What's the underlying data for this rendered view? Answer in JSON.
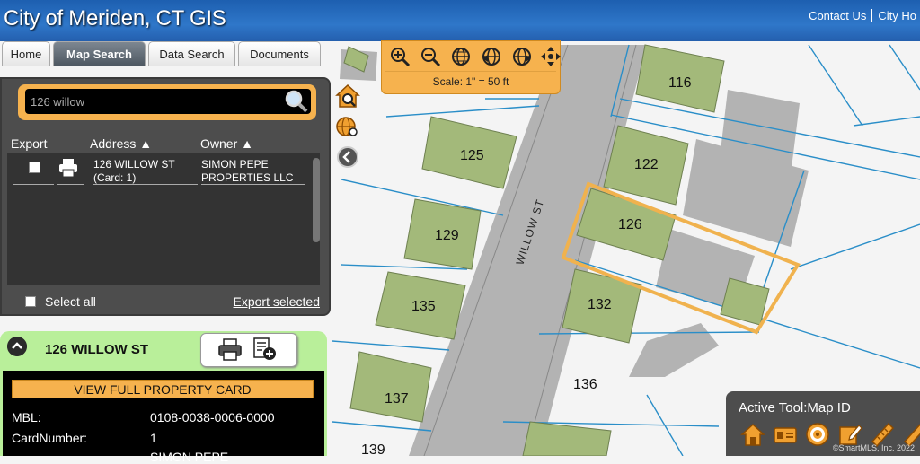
{
  "header": {
    "title": "City of Meriden, CT GIS",
    "links": [
      "Contact Us",
      "City Ho"
    ]
  },
  "tabs": [
    {
      "label": "Home",
      "active": false
    },
    {
      "label": "Map Search",
      "active": true
    },
    {
      "label": "Data Search",
      "active": false
    },
    {
      "label": "Documents",
      "active": false
    }
  ],
  "map_toolbar": {
    "tools": [
      "zoom-in-icon",
      "zoom-out-icon",
      "full-extent-globe-icon",
      "previous-extent-globe-icon",
      "next-extent-globe-icon",
      "pan-icon"
    ],
    "scale": "Scale: 1\" = 50 ft"
  },
  "search": {
    "value": "126 willow",
    "columns": {
      "export": "Export",
      "address": "Address ▲",
      "owner": "Owner ▲"
    },
    "results": [
      {
        "address_line1": "126 WILLOW ST",
        "address_line2": "(Card: 1)",
        "owner_line1": "SIMON PEPE",
        "owner_line2": "PROPERTIES LLC"
      }
    ],
    "select_all": "Select all",
    "export_selected": "Export selected"
  },
  "side_icons": [
    "home-search-icon",
    "globe-search-icon",
    "collapse-left-icon"
  ],
  "detail": {
    "address": "126 WILLOW ST",
    "view_card": "VIEW FULL PROPERTY CARD",
    "fields": [
      {
        "label": "MBL:",
        "value": "0108-0038-0006-0000"
      },
      {
        "label": "CardNumber:",
        "value": "1"
      },
      {
        "label": "",
        "value": "SIMON PEPE"
      }
    ]
  },
  "active_tool": {
    "label": "Active Tool:Map ID",
    "tools": [
      "home-icon",
      "id-card-icon",
      "target-icon",
      "edit-icon",
      "measure-icon",
      "ruler-icon"
    ],
    "copyright": "©SmartMLS, Inc. 2022"
  },
  "map": {
    "street_label": "WILLOW ST",
    "parcel_labels": [
      "116",
      "125",
      "122",
      "126",
      "129",
      "135",
      "132",
      "136",
      "137",
      "139"
    ],
    "colors": {
      "building": "#a3b97a",
      "road": "#b3b3b3",
      "parcel_line": "#2a8ec8",
      "selected": "#f0b24e"
    }
  }
}
